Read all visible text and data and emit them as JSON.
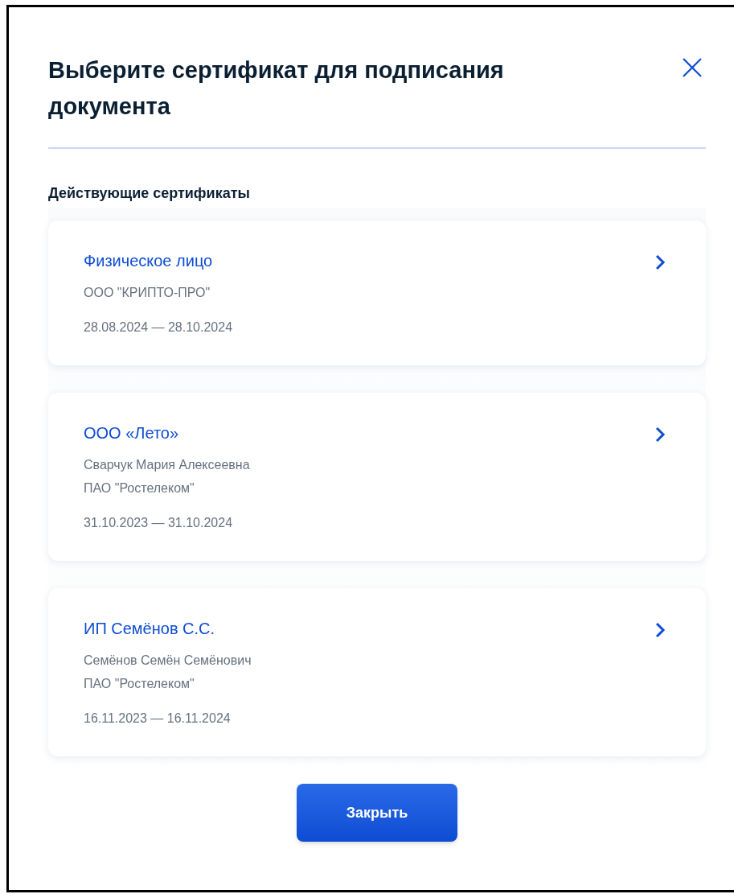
{
  "dialog": {
    "title": "Выберите сертификат для подписания документа"
  },
  "section_heading": "Действующие сертификаты",
  "certificates": [
    {
      "name": "Физическое лицо",
      "details": [
        "ООО \"КРИПТО-ПРО\""
      ],
      "validity": "28.08.2024 — 28.10.2024"
    },
    {
      "name": "ООО «Лето»",
      "details": [
        "Сварчук Мария Алексеевна",
        "ПАО \"Ростелеком\""
      ],
      "validity": "31.10.2023 — 31.10.2024"
    },
    {
      "name": "ИП Семёнов С.С.",
      "details": [
        "Семёнов Семён Семёнович",
        "ПАО \"Ростелеком\""
      ],
      "validity": "16.11.2023 — 16.11.2024"
    }
  ],
  "close_button": "Закрыть"
}
